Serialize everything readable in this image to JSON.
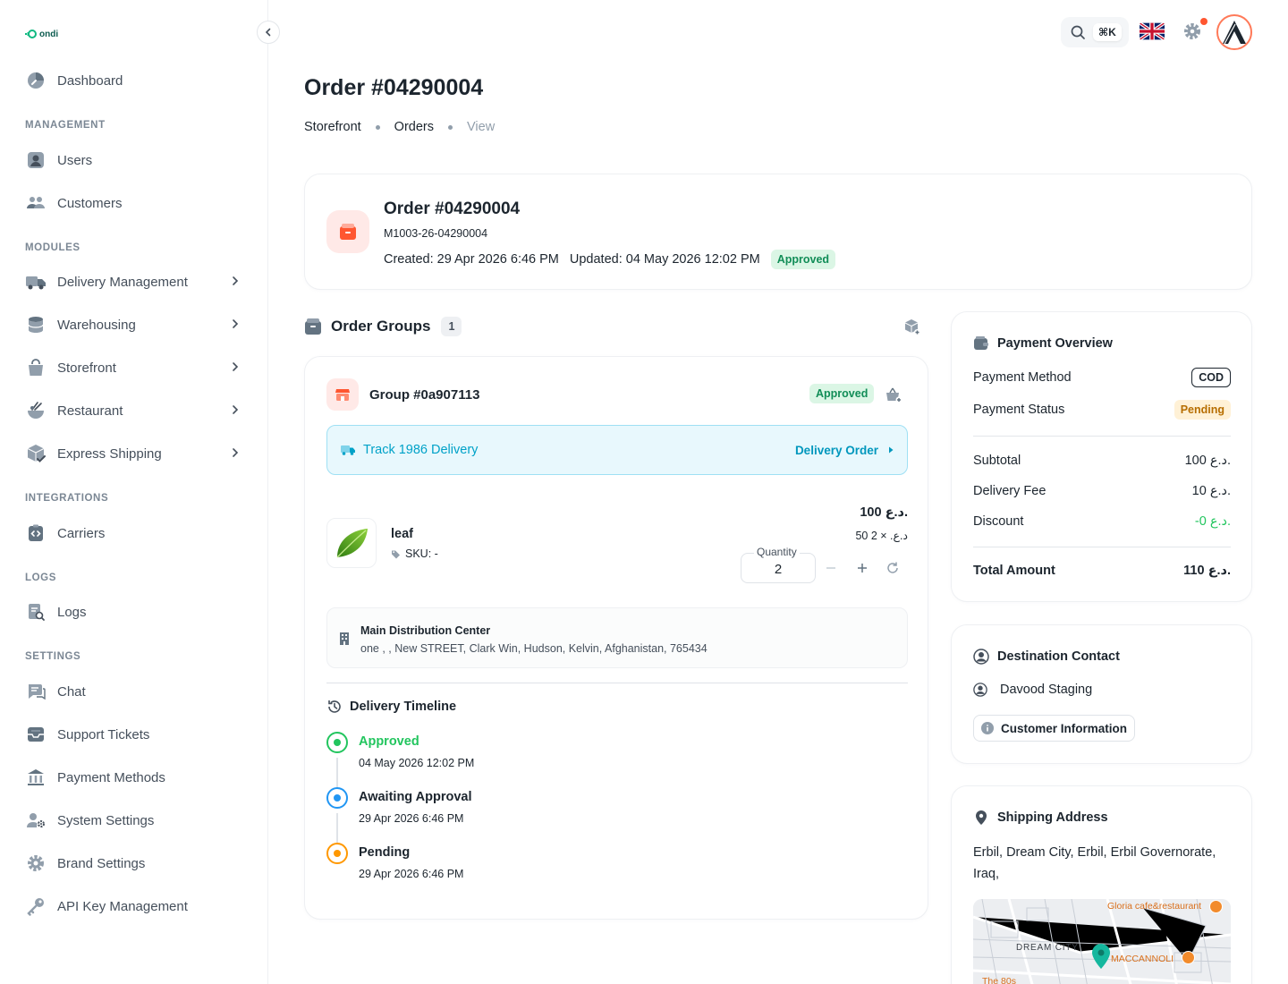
{
  "brand": {
    "name": "ondi",
    "accent": "#10b981"
  },
  "sidebar": {
    "dashboard": "Dashboard",
    "sections": {
      "management": "MANAGEMENT",
      "modules": "MODULES",
      "integrations": "INTEGRATIONS",
      "logs": "LOGS",
      "settings": "SETTINGS"
    },
    "management_items": [
      "Users",
      "Customers"
    ],
    "module_items": [
      "Delivery Management",
      "Warehousing",
      "Storefront",
      "Restaurant",
      "Express Shipping"
    ],
    "integration_items": [
      "Carriers"
    ],
    "log_items": [
      "Logs"
    ],
    "settings_items": [
      "Chat",
      "Support Tickets",
      "Payment Methods",
      "System Settings",
      "Brand Settings",
      "API Key Management"
    ]
  },
  "topbar": {
    "shortcut": "⌘K",
    "language": "English (UK)"
  },
  "page": {
    "title": "Order #04290004",
    "breadcrumb": [
      "Storefront",
      "Orders",
      "View"
    ]
  },
  "order": {
    "title": "Order #04290004",
    "reference": "M1003-26-04290004",
    "created": "Created: 29 Apr 2026 6:46 PM",
    "updated": "Updated: 04 May 2026 12:02 PM",
    "status": "Approved"
  },
  "groups": {
    "heading": "Order Groups",
    "count": "1",
    "group": {
      "title": "Group #0a907113",
      "status": "Approved",
      "track_label": "Track 1986 Delivery",
      "track_link": "Delivery Order",
      "product": {
        "name": "leaf",
        "sku": "SKU: -",
        "price": "100 د.ع.",
        "unit": "50 د.ع. × 2",
        "quantity_label": "Quantity",
        "quantity": "2"
      },
      "warehouse": {
        "name": "Main Distribution Center",
        "address": "one , , New STREET, Clark Win, Hudson, Kelvin, Afghanistan, 765434"
      },
      "timeline": {
        "heading": "Delivery Timeline",
        "events": [
          {
            "title": "Approved",
            "date": "04 May 2026 12:02 PM",
            "color": "#22c55e"
          },
          {
            "title": "Awaiting Approval",
            "date": "29 Apr 2026 6:46 PM",
            "color": "#2196f3"
          },
          {
            "title": "Pending",
            "date": "29 Apr 2026 6:46 PM",
            "color": "#ff9800"
          }
        ]
      }
    }
  },
  "payment": {
    "heading": "Payment Overview",
    "method_label": "Payment Method",
    "method_value": "COD",
    "status_label": "Payment Status",
    "status_value": "Pending",
    "subtotal_label": "Subtotal",
    "subtotal_value": "100 د.ع.",
    "fee_label": "Delivery Fee",
    "fee_value": "10 د.ع.",
    "discount_label": "Discount",
    "discount_value": "-0 د.ع.",
    "total_label": "Total Amount",
    "total_value": "110 د.ع."
  },
  "contact": {
    "heading": "Destination Contact",
    "name": "Davood Staging",
    "info_button": "Customer Information"
  },
  "shipping": {
    "heading": "Shipping Address",
    "address": "Erbil, Dream City, Erbil, Erbil Governorate, Iraq,",
    "map_labels": {
      "poi1": "Gloria cafe&restaurant",
      "area": "DREAM CITY",
      "poi2": "MACCANNOLI",
      "poi3": "The 80s"
    }
  }
}
